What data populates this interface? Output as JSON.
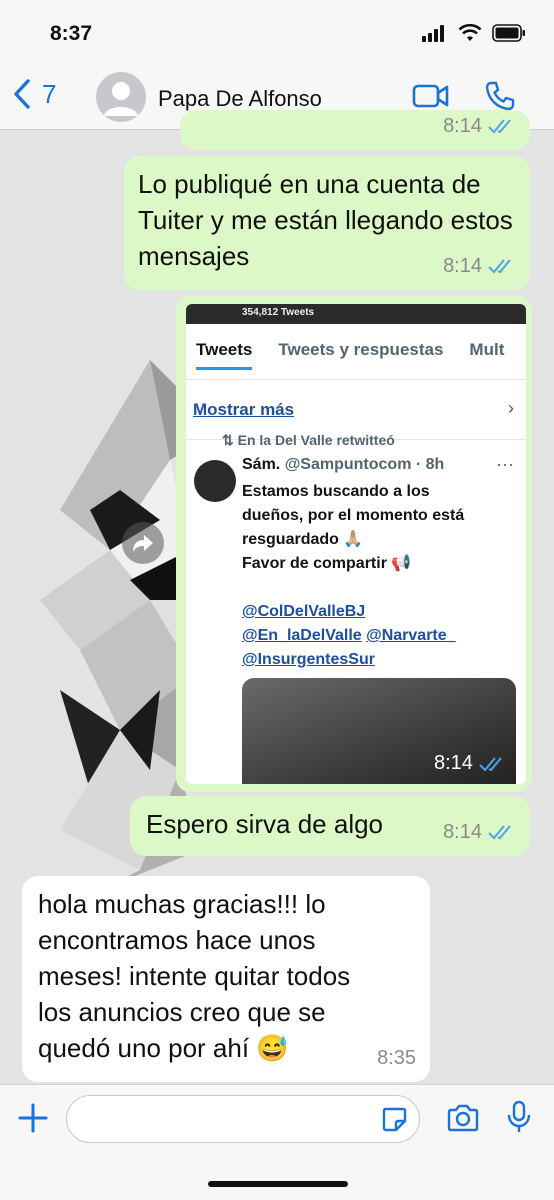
{
  "status_bar": {
    "time": "8:37"
  },
  "header": {
    "back_count": "7",
    "contact_name": "Papa De Alfonso"
  },
  "messages": [
    {
      "type": "out",
      "text": "",
      "time": "8:14",
      "partial": true
    },
    {
      "type": "out",
      "text": "Lo publiqué en una cuenta de Tuiter y me están llegando estos mensajes",
      "time": "8:14"
    },
    {
      "type": "out-image",
      "time": "8:14"
    },
    {
      "type": "out",
      "text": "Espero sirva de algo",
      "time": "8:14"
    },
    {
      "type": "in",
      "text": "hola muchas gracias!!! lo encontramos hace unos meses! intente quitar todos los anuncios creo que se quedó uno por ahí 😅",
      "time": "8:35"
    }
  ],
  "tweet_screenshot": {
    "tweet_count": "354,812 Tweets",
    "tabs": [
      "Tweets",
      "Tweets y respuestas",
      "Mult"
    ],
    "show_more": "Mostrar más",
    "retweeted_by": "En la Del Valle retwitteó",
    "author_name": "Sám.",
    "author_handle": "@Sampuntocom · 8h",
    "text_lines": [
      "Estamos buscando a los",
      "dueños, por el momento está",
      "resguardado 🙏🏼",
      "Favor de compartir 📢"
    ],
    "mentions": [
      "@ColDelValleBJ",
      "@En_laDelValle",
      "@Narvarte_",
      "@InsurgentesSur"
    ]
  },
  "colors": {
    "accent": "#1a73d9",
    "outgoing_bubble": "#dcf8c6",
    "incoming_bubble": "#ffffff",
    "read_ticks": "#4fa3e8"
  },
  "icons": [
    "back-chevron-icon",
    "video-call-icon",
    "phone-icon",
    "forward-icon",
    "plus-icon",
    "sticker-icon",
    "camera-icon",
    "microphone-icon",
    "read-ticks-icon"
  ]
}
